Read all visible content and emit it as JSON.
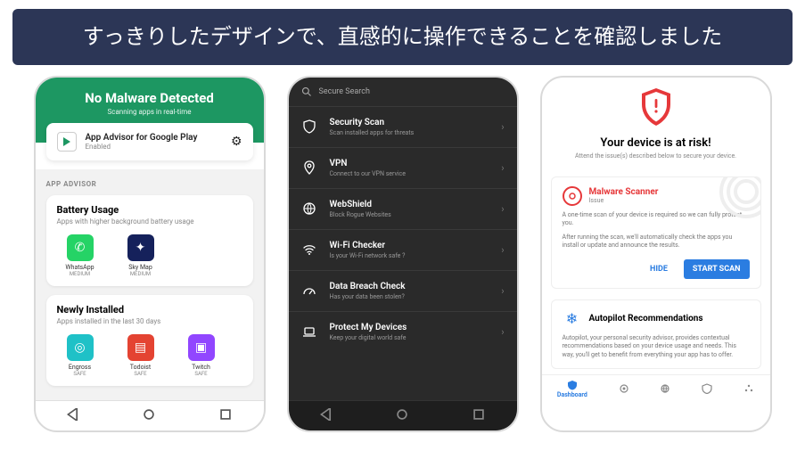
{
  "banner": "すっきりしたデザインで、直感的に操作できることを確認しました",
  "phone1": {
    "header_title": "No Malware Detected",
    "header_sub": "Scanning apps in real-time",
    "advisor_title": "App Advisor for Google Play",
    "advisor_status": "Enabled",
    "section_label": "APP ADVISOR",
    "battery": {
      "title": "Battery Usage",
      "sub": "Apps with higher background battery usage",
      "apps": [
        {
          "name": "WhatsApp",
          "status": "MEDIUM",
          "color": "#25D366",
          "glyph": "✆"
        },
        {
          "name": "Sky Map",
          "status": "MEDIUM",
          "color": "#15215b",
          "glyph": "✦"
        }
      ]
    },
    "newly": {
      "title": "Newly Installed",
      "sub": "Apps installed in the last 30 days",
      "apps": [
        {
          "name": "Engross",
          "status": "SAFE",
          "color": "#1fc1c7",
          "glyph": "◎"
        },
        {
          "name": "Todoist",
          "status": "SAFE",
          "color": "#e44332",
          "glyph": "▤"
        },
        {
          "name": "Twitch",
          "status": "SAFE",
          "color": "#9146ff",
          "glyph": "▣"
        }
      ]
    }
  },
  "phone2": {
    "search_placeholder": "Secure Search",
    "items": [
      {
        "title": "Security Scan",
        "sub": "Scan installed apps for threats",
        "icon": "shield"
      },
      {
        "title": "VPN",
        "sub": "Connect to our VPN service",
        "icon": "pin"
      },
      {
        "title": "WebShield",
        "sub": "Block Rogue Websites",
        "icon": "globe"
      },
      {
        "title": "Wi-Fi Checker",
        "sub": "Is your Wi-Fi network safe ?",
        "icon": "wifi"
      },
      {
        "title": "Data Breach Check",
        "sub": "Has your data been stolen?",
        "icon": "gauge"
      },
      {
        "title": "Protect My Devices",
        "sub": "Keep your digital world safe",
        "icon": "laptop"
      }
    ]
  },
  "phone3": {
    "title": "Your device is at risk!",
    "sub": "Attend the issue(s) described below to secure your device.",
    "malware": {
      "title": "Malware Scanner",
      "issue": "Issue",
      "body1": "A one-time scan of your device is required so we can fully protect you.",
      "body2": "After running the scan, we'll automatically check the apps you install or update and announce the results.",
      "hide": "HIDE",
      "scan": "START SCAN"
    },
    "autopilot": {
      "title": "Autopilot Recommendations",
      "body": "Autopilot, your personal security advisor, provides contextual recommendations based on your device usage and needs. This way, you'll get to benefit from everything your app has to offer."
    },
    "tabs": {
      "dashboard": "Dashboard"
    }
  }
}
